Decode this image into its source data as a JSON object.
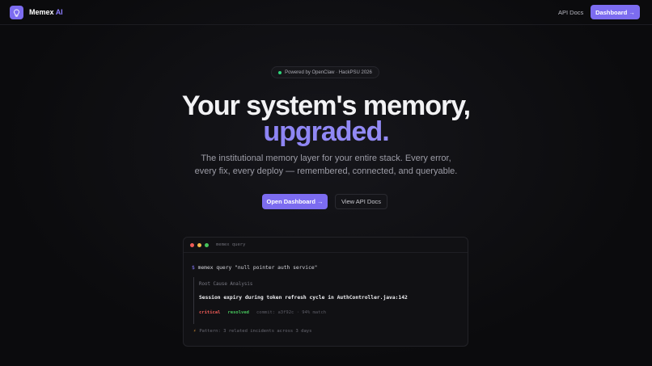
{
  "nav": {
    "brand_name": "Memex",
    "brand_suffix": "AI",
    "api_docs": "API Docs",
    "dashboard_button": "Dashboard →"
  },
  "hero": {
    "badge": "Powered by OpenClaw · HackPSU 2026",
    "title_line1": "Your system's memory,",
    "title_line2": "upgraded.",
    "subtitle_line1": "The institutional memory layer for your entire stack. Every error,",
    "subtitle_line2": "every fix, every deploy — remembered, connected, and queryable.",
    "primary_button": "Open Dashboard →",
    "secondary_button": "View API Docs"
  },
  "terminal": {
    "title": "memex query",
    "prompt": "$",
    "command": "memex query \"null pointer auth service\"",
    "section_title": "Root Cause Analysis",
    "finding": "Session expiry during token refresh cycle in AuthController.java:142",
    "tag_critical": "critical",
    "tag_resolved": "resolved",
    "meta": "commit: a3f92c · 94% match",
    "pattern": "Pattern: 3 related incidents across 3 days"
  },
  "colors": {
    "accent": "#7c6cf0",
    "background": "#0b0b0d",
    "critical": "#ef5b57",
    "resolved": "#46c45b"
  },
  "icons": {
    "logo": "lightbulb-icon",
    "pattern": "lightning-icon"
  }
}
